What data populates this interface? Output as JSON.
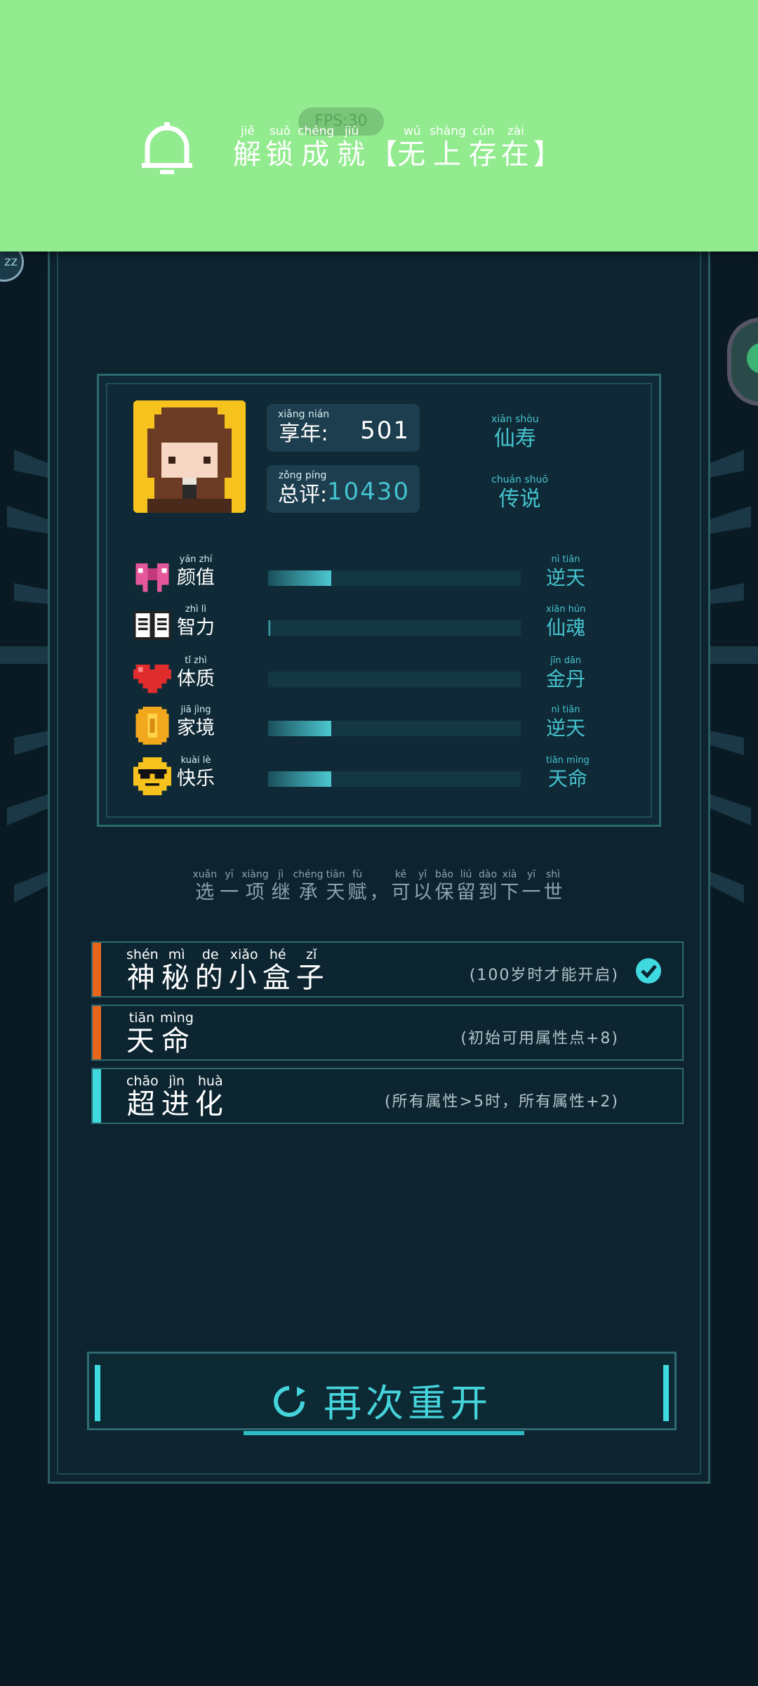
{
  "banner": {
    "fps": "FPS:30",
    "title": [
      {
        "py": "jiě",
        "hz": "解"
      },
      {
        "py": "suǒ",
        "hz": "锁"
      },
      {
        "py": "chéng",
        "hz": "成"
      },
      {
        "py": "jiù",
        "hz": "就"
      }
    ],
    "bracket_open": "【",
    "name": [
      {
        "py": "wú",
        "hz": "无"
      },
      {
        "py": "shàng",
        "hz": "上"
      },
      {
        "py": "cún",
        "hz": "存"
      },
      {
        "py": "zài",
        "hz": "在"
      }
    ],
    "bracket_close": "】"
  },
  "summary": {
    "age": {
      "label_py": "xiǎng nián",
      "label": "享年:",
      "value": "501",
      "grade_py": "xiān shòu",
      "grade": "仙寿"
    },
    "score": {
      "label_py": "zǒng píng",
      "label": "总评:",
      "value": "10430",
      "grade_py": "chuán shuō",
      "grade": "传说"
    }
  },
  "attributes": [
    {
      "icon": "bow-icon",
      "name_py": "yán zhí",
      "name": "颜值",
      "level": 0.25,
      "grade_py": "nì tiān",
      "grade": "逆天"
    },
    {
      "icon": "book-icon",
      "name_py": "zhì lì",
      "name": "智力",
      "level": 0.01,
      "grade_py": "xiān hún",
      "grade": "仙魂"
    },
    {
      "icon": "heart-icon",
      "name_py": "tǐ zhì",
      "name": "体质",
      "level": 0.0,
      "grade_py": "jīn dān",
      "grade": "金丹"
    },
    {
      "icon": "coin-icon",
      "name_py": "jiā jìng",
      "name": "家境",
      "level": 0.25,
      "grade_py": "nì tiān",
      "grade": "逆天"
    },
    {
      "icon": "sunglasses-face-icon",
      "name_py": "kuài lè",
      "name": "快乐",
      "level": 0.25,
      "grade_py": "tiān mìng",
      "grade": "天命"
    }
  ],
  "hint": [
    {
      "py": "xuǎn",
      "hz": "选"
    },
    {
      "py": "yī",
      "hz": "一"
    },
    {
      "py": "xiàng",
      "hz": "项"
    },
    {
      "py": "jì",
      "hz": "继"
    },
    {
      "py": "chéng",
      "hz": "承"
    },
    {
      "py": "tiān",
      "hz": "天"
    },
    {
      "py": "fù",
      "hz": "赋"
    },
    {
      "py": "",
      "hz": "，"
    },
    {
      "py": "kě",
      "hz": "可"
    },
    {
      "py": "yǐ",
      "hz": "以"
    },
    {
      "py": "bǎo",
      "hz": "保"
    },
    {
      "py": "liú",
      "hz": "留"
    },
    {
      "py": "dào",
      "hz": "到"
    },
    {
      "py": "xià",
      "hz": "下"
    },
    {
      "py": "yī",
      "hz": "一"
    },
    {
      "py": "shì",
      "hz": "世"
    }
  ],
  "talents": [
    {
      "name_py": [
        "shén",
        "mì",
        "de",
        "xiǎo",
        "hé",
        "zǐ"
      ],
      "name": [
        "神",
        "秘",
        "的",
        "小",
        "盒",
        "子"
      ],
      "desc": "(100岁时才能开启)",
      "stripe": "#e6661a",
      "selected": true
    },
    {
      "name_py": [
        "tiān",
        "mìng"
      ],
      "name": [
        "天",
        "命"
      ],
      "desc": "(初始可用属性点+8)",
      "stripe": "#e6661a",
      "selected": false
    },
    {
      "name_py": [
        "chāo",
        "jìn",
        "huà"
      ],
      "name": [
        "超",
        "进",
        "化"
      ],
      "desc": "(所有属性>5时，所有属性+2)",
      "stripe": "#3fd9e0",
      "selected": false
    }
  ],
  "restart_label": "再次重开",
  "colors": {
    "accent": "#45c3cf",
    "banner": "#92eb8e",
    "panel": "#0d2430"
  }
}
